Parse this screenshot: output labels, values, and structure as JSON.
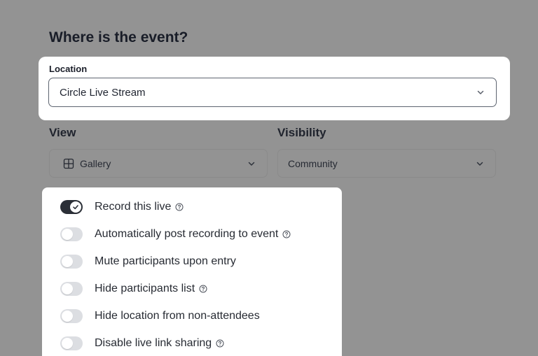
{
  "section_title": "Where is the event?",
  "location": {
    "label": "Location",
    "value": "Circle Live Stream",
    "icon": "chevron-down-icon"
  },
  "view": {
    "label": "View",
    "value": "Gallery",
    "icon": "grid-icon"
  },
  "visibility": {
    "label": "Visibility",
    "value": "Community"
  },
  "colors": {
    "overlay": "#939393",
    "toggle_on": "#2b2f37",
    "toggle_off": "#dcdee2",
    "text": "#191d28"
  },
  "options": [
    {
      "label": "Record this live",
      "enabled": true,
      "help": true
    },
    {
      "label": "Automatically post recording to event",
      "enabled": false,
      "help": true
    },
    {
      "label": "Mute participants upon entry",
      "enabled": false,
      "help": false
    },
    {
      "label": "Hide participants list",
      "enabled": false,
      "help": true
    },
    {
      "label": "Hide location from non-attendees",
      "enabled": false,
      "help": false
    },
    {
      "label": "Disable live link sharing",
      "enabled": false,
      "help": true
    }
  ]
}
